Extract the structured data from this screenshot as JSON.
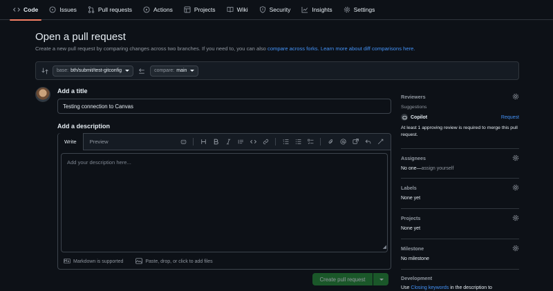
{
  "nav": {
    "items": [
      {
        "label": "Code",
        "icon": "code-icon",
        "active": true
      },
      {
        "label": "Issues",
        "icon": "issue-icon"
      },
      {
        "label": "Pull requests",
        "icon": "pull-request-icon"
      },
      {
        "label": "Actions",
        "icon": "play-icon"
      },
      {
        "label": "Projects",
        "icon": "table-icon"
      },
      {
        "label": "Wiki",
        "icon": "book-icon"
      },
      {
        "label": "Security",
        "icon": "shield-icon"
      },
      {
        "label": "Insights",
        "icon": "graph-icon"
      },
      {
        "label": "Settings",
        "icon": "gear-icon"
      }
    ]
  },
  "header": {
    "title": "Open a pull request",
    "subtitle_text": "Create a new pull request by comparing changes across two branches. If you need to, you can also ",
    "subtitle_link1": "compare across forks.",
    "subtitle_link2": "Learn more about diff comparisons here."
  },
  "compare": {
    "base_prefix": "base:",
    "base_branch": "bth/submit/test-gitconfig",
    "compare_prefix": "compare:",
    "compare_branch": "main"
  },
  "form": {
    "title_label": "Add a title",
    "title_value": "Testing connection to Canvas",
    "desc_label": "Add a description",
    "tab_write": "Write",
    "tab_preview": "Preview",
    "desc_placeholder": "Add your description here...",
    "markdown_note": "Markdown is supported",
    "files_note": "Paste, drop, or click to add files",
    "submit_label": "Create pull request"
  },
  "sidebar": {
    "reviewers_title": "Reviewers",
    "suggestions_label": "Suggestions",
    "copilot_name": "Copilot",
    "request_label": "Request",
    "review_note": "At least 1 approving review is required to merge this pull request.",
    "assignees_title": "Assignees",
    "assignees_none": "No one—",
    "assign_yourself": "assign yourself",
    "labels_title": "Labels",
    "labels_value": "None yet",
    "projects_title": "Projects",
    "projects_value": "None yet",
    "milestone_title": "Milestone",
    "milestone_value": "No milestone",
    "development_title": "Development",
    "development_text_prefix": "Use ",
    "development_link": "Closing keywords",
    "development_text_suffix": " in the description to"
  },
  "colors": {
    "accent": "#f78166",
    "link": "#4493f8",
    "primary_button": "#238636",
    "background": "#0d1117"
  }
}
